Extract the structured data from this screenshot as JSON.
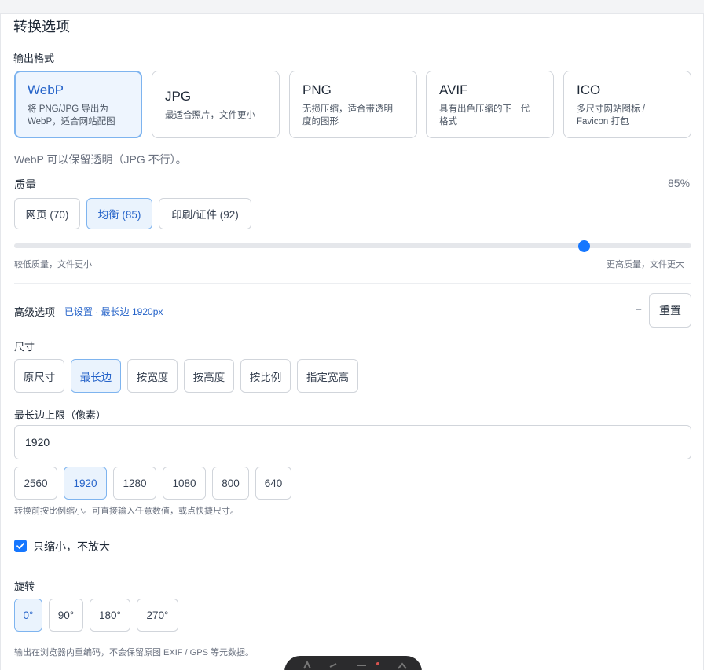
{
  "title": "转换选项",
  "output_format": {
    "label": "输出格式",
    "options": [
      {
        "name": "WebP",
        "desc1": "将 PNG/JPG 导出为",
        "desc2": "WebP，适合网站配图",
        "active": true
      },
      {
        "name": "JPG",
        "desc1": "最适合照片，文件更小",
        "desc2": "",
        "active": false
      },
      {
        "name": "PNG",
        "desc1": "无损压缩，适合带透明",
        "desc2": "度的图形",
        "active": false
      },
      {
        "name": "AVIF",
        "desc1": "具有出色压缩的下一代",
        "desc2": "格式",
        "active": false
      },
      {
        "name": "ICO",
        "desc1": "多尺寸网站图标 /",
        "desc2": "Favicon 打包",
        "active": false
      }
    ],
    "note": "WebP 可以保留透明（JPG 不行）。"
  },
  "quality": {
    "label": "质量",
    "value_text": "85%",
    "value": 85,
    "presets": [
      "网页 (70)",
      "均衡 (85)",
      "印刷/证件 (92)"
    ],
    "active_preset": 1,
    "low_hint": "较低质量，文件更小",
    "high_hint": "更高质量，文件更大"
  },
  "advanced": {
    "label": "高级选项",
    "summary": "已设置 · 最长边 1920px",
    "collapse_symbol": "–",
    "reset_label": "重置"
  },
  "size": {
    "label": "尺寸",
    "modes": [
      "原尺寸",
      "最长边",
      "按宽度",
      "按高度",
      "按比例",
      "指定宽高"
    ],
    "active_mode": 1,
    "limit_label": "最长边上限（像素）",
    "limit_value": "1920",
    "quick_sizes": [
      "2560",
      "1920",
      "1280",
      "1080",
      "800",
      "640"
    ],
    "active_quick": 1,
    "hint": "转换前按比例缩小。可直接输入任意数值，或点快捷尺寸。"
  },
  "shrink_only": {
    "label": "只缩小，不放大",
    "checked": true
  },
  "rotate": {
    "label": "旋转",
    "options": [
      "0°",
      "90°",
      "180°",
      "270°"
    ],
    "active": 0
  },
  "footer_note": "输出在浏览器内重编码，不会保留原图 EXIF / GPS 等元数据。",
  "colors": {
    "accent": "#1677ff",
    "active_border": "#7eb4ef",
    "active_bg": "#eaf3fd",
    "active_text": "#2563c9"
  }
}
